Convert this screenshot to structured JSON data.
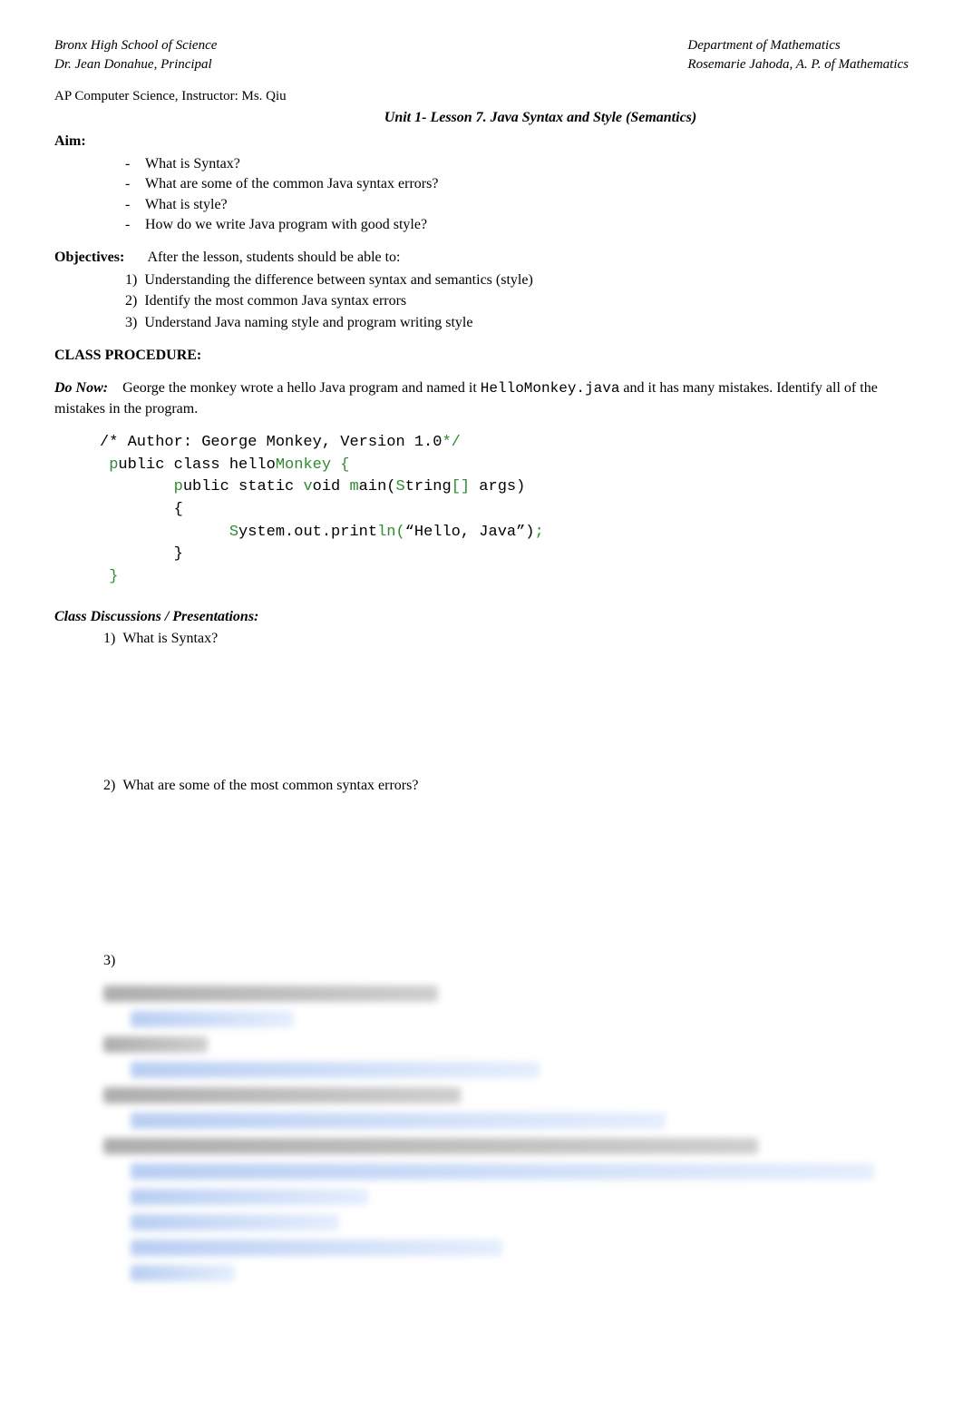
{
  "header": {
    "school": "Bronx High School of Science",
    "dept": "Department of Mathematics",
    "principal": "Dr. Jean Donahue, Principal",
    "ap": "Rosemarie Jahoda, A. P. of Mathematics"
  },
  "instructor_line": "AP Computer Science, Instructor: Ms. Qiu",
  "unit_title": "Unit 1- Lesson 7. Java Syntax and Style (Semantics)",
  "aim_label": "Aim:",
  "aim_items": [
    "What is Syntax?",
    "What are some of the common Java syntax errors?",
    "What is style?",
    "How do we write Java program with good style?"
  ],
  "objectives_label": "Objectives:",
  "objectives_intro": "After the lesson, students should be able to:",
  "objectives_items": [
    "Understanding the difference between syntax and semantics (style)",
    "Identify the most common Java syntax errors",
    "Understand Java naming style and program writing style"
  ],
  "class_proc": "CLASS PROCEDURE:",
  "donow_label": "Do Now:",
  "donow_text_1": "George the monkey wrote a hello Java program and named it ",
  "donow_code": "HelloMonkey.java",
  "donow_text_2": " and it has many mistakes. Identify all of the mistakes in the program.",
  "code": {
    "l1a": "/* Author: George Monkey, Version 1.0",
    "l1b": "*/",
    "l2a": " p",
    "l2b": "ublic class hello",
    "l2c": "Monkey {",
    "l3a": "        p",
    "l3b": "ublic static ",
    "l3c": "v",
    "l3d": "oid ",
    "l3e": "m",
    "l3f": "ain(",
    "l3g": "S",
    "l3h": "tring",
    "l3i": "[]",
    "l3j": " args)",
    "l4": "        {",
    "l5a": "              S",
    "l5b": "ystem.out.print",
    "l5c": "ln(",
    "l5d": "“Hello, Java”)",
    "l5e": ";",
    "l6": "        }",
    "l7": " }"
  },
  "class_disc": "Class Discussions / Presentations:",
  "questions": [
    "What is Syntax?",
    "What are some of the most common syntax errors?",
    ""
  ]
}
